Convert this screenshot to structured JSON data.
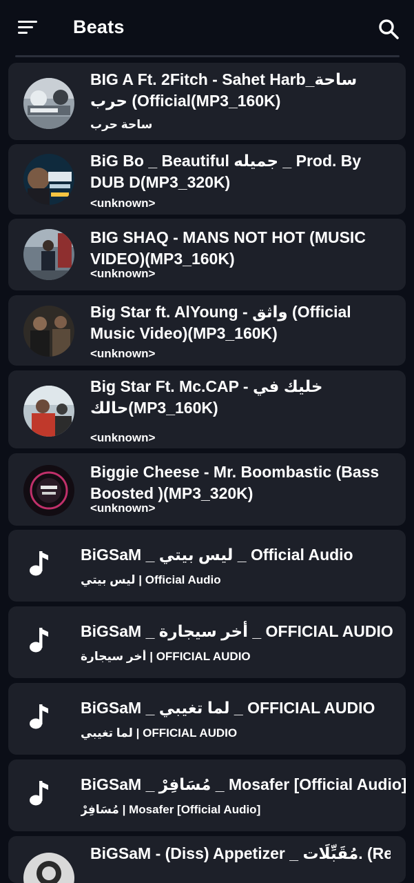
{
  "header": {
    "title": "Beats",
    "menu_icon": "sort-menu-icon",
    "search_icon": "search-icon"
  },
  "colors": {
    "background": "#0b0e17",
    "card": "#1d2029",
    "text": "#ffffff"
  },
  "tracks": [
    {
      "title": "BIG A Ft. 2Fitch - Sahet Harb_ساحة حرب (Official(MP3_160K)",
      "subtitle": "ساحة حرب",
      "icon": "album-art"
    },
    {
      "title": "BiG Bo _ Beautiful جميله _ Prod. By DUB D(MP3_320K)",
      "subtitle": "<unknown>",
      "icon": "album-art"
    },
    {
      "title": "BIG SHAQ - MANS NOT HOT (MUSIC VIDEO)(MP3_160K)",
      "subtitle": "<unknown>",
      "icon": "album-art"
    },
    {
      "title": "Big Star ft. AlYoung - واثق (Official Music Video)(MP3_160K)",
      "subtitle": "<unknown>",
      "icon": "album-art"
    },
    {
      "title": "Big Star Ft. Mc.CAP - خليك في حالك(MP3_160K)",
      "subtitle": "<unknown>",
      "icon": "album-art"
    },
    {
      "title": "Biggie Cheese - Mr. Boombastic (Bass Boosted )(MP3_320K)",
      "subtitle": "<unknown>",
      "icon": "album-art"
    },
    {
      "title": "BiGSaM _ ليس بيتي _ Official Audio",
      "subtitle": "ليس بيتي | Official Audio",
      "icon": "music-note-icon"
    },
    {
      "title": "BiGSaM _ أخر سيجارة _ OFFICIAL AUDIO",
      "subtitle": "أخر سيجارة | OFFICIAL AUDIO",
      "icon": "music-note-icon"
    },
    {
      "title": "BiGSaM _ لما تغيبي _ OFFICIAL AUDIO",
      "subtitle": "لما تغيبي | OFFICIAL AUDIO",
      "icon": "music-note-icon"
    },
    {
      "title": "BiGSaM _ مُسَافِرْ _ Mosafer [Official Audio]",
      "subtitle": "مُسَافِرْ | Mosafer [Official Audio]",
      "icon": "music-note-icon"
    },
    {
      "title": "BiGSaM  - (Diss) Appetizer _ مُقَبِّلَات. (Re-",
      "subtitle": "",
      "icon": "album-art"
    }
  ]
}
